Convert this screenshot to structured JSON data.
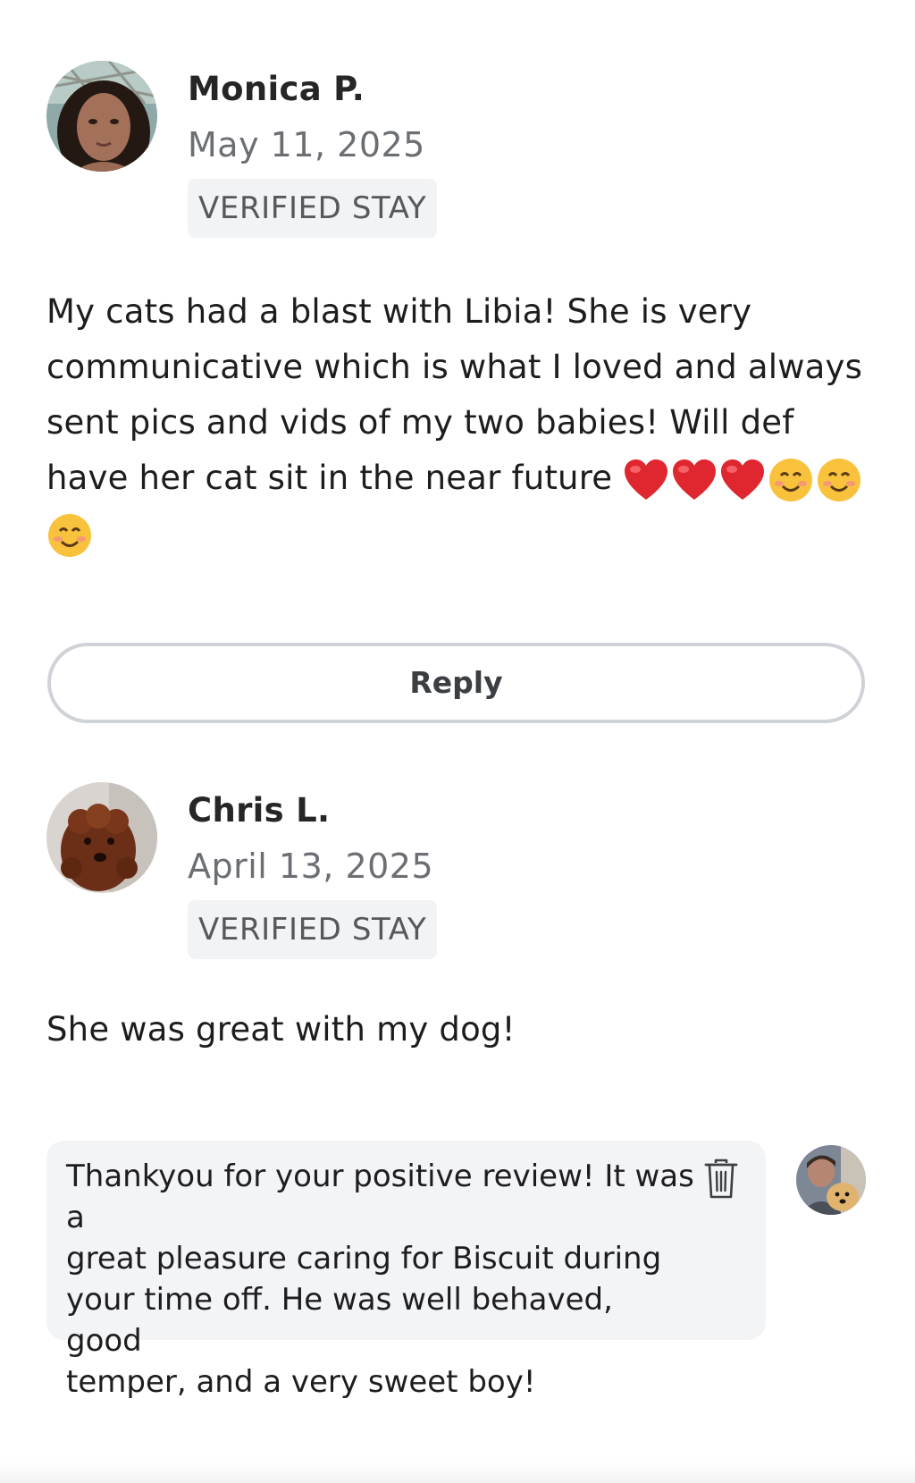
{
  "reviews": [
    {
      "name": "Monica P.",
      "date": "May 11, 2025",
      "badge": "VERIFIED STAY",
      "lines": [
        "My cats had a blast with Libia! She is very",
        "communicative which is what I loved and always",
        "sent pics and vids of my two babies! Will def",
        "have her cat sit in the near future"
      ],
      "emojis": [
        "red-heart",
        "red-heart",
        "red-heart",
        "smiling-face",
        "smiling-face",
        "smiling-face"
      ]
    },
    {
      "name": "Chris L.",
      "date": "April 13, 2025",
      "badge": "VERIFIED STAY",
      "text": "She was great with my dog!"
    }
  ],
  "reply_button": {
    "label": "Reply"
  },
  "owner_response": {
    "lines": [
      "Thankyou for your positive review! It was a",
      "great pleasure caring for Biscuit during",
      "your time off. He was well behaved, good",
      "temper, and a very sweet boy!"
    ],
    "delete_icon": "trash-icon"
  },
  "colors": {
    "badge_bg": "#f2f3f5",
    "response_bg": "#f3f4f6",
    "button_border": "#cfd3d8",
    "muted_text": "#6b6e73"
  }
}
